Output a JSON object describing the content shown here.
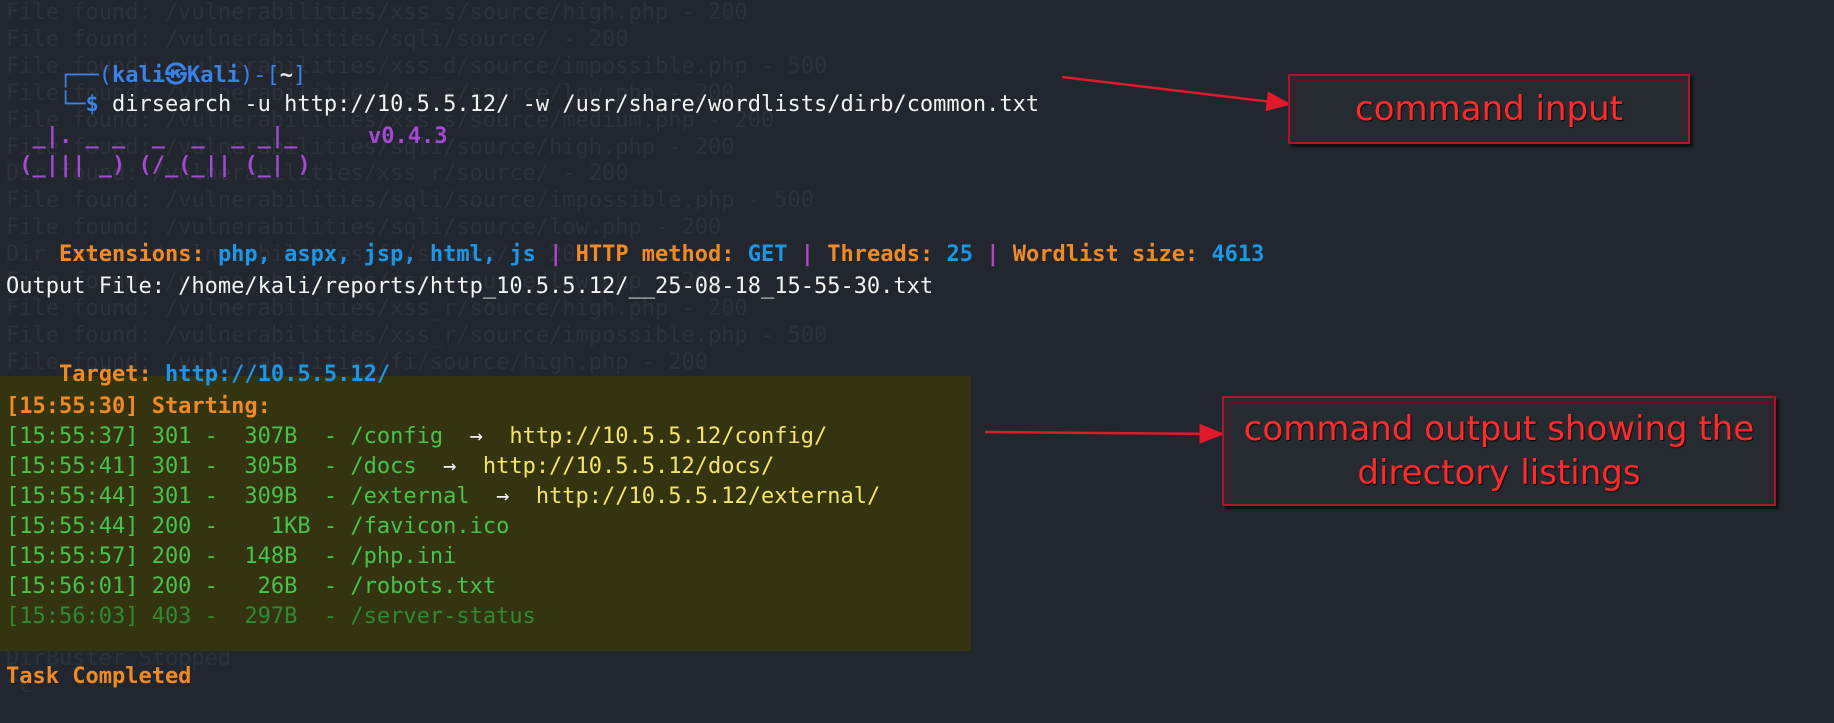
{
  "background_text": [
    "File found: /vulnerabilities/xss_s/source/high.php - 200",
    "File found: /vulnerabilities/sqli/source/ - 200",
    "File found: /vulnerabilities/xss_d/source/impossible.php - 500",
    "File found: /vulnerabilities/xss_s/source/low.php - 200",
    "File found: /vulnerabilities/xss_s/source/medium.php - 200",
    "File found: /vulnerabilities/sqli/source/high.php - 200",
    "Dir found: /vulnerabilities/xss_r/source/ - 200",
    "File found: /vulnerabilities/sqli/source/impossible.php - 500",
    "File found: /vulnerabilities/sqli/source/low.php - 200",
    "Dir found: /vulnerabilities/fi/source/ - 200",
    "File found: /vulnerabilities/csrf/source/low.php - 200",
    "File found: /vulnerabilities/xss_r/source/high.php - 200",
    "File found: /vulnerabilities/xss_r/source/impossible.php - 500",
    "File found: /vulnerabilities/fi/source/high.php - 200",
    "File found: /vulnerabilities/xss_r/source/low.php - 200",
    "File found: /vulnerabilities/xss_r/source/medium.php - 200",
    "File found: /vulnerabilities/fi/source/low.php - 200",
    "File found: /vulnerabilities/fi/source/medium.php - 200",
    "File found: /vulnerabilities/fi/source/impossible.php - 500",
    "File found: /vulnerabilities/csrf/source/high.php - 500",
    "File found: /vulnerabilities/csrf/source/impossible.php - 500",
    "File found: /vulnerabilities/csrf/source/low.php - 200",
    "File found: /vulnerabilities/csrf/source/medium.php - 200",
    "File found: /vulnerabilities/fi/include.php - 500",
    "DirBuster Stopped",
    "^C"
  ],
  "prompt": {
    "corner_top": "┌──(",
    "user": "kali",
    "at_symbol": "㉿",
    "host": "Kali",
    "dir_open": ")-[",
    "dir": "~",
    "dir_close": "]",
    "corner_bottom": "└─",
    "dollar": "$",
    "command": "dirsearch -u http://10.5.5.12/ -w /usr/share/wordlists/dirb/common.txt"
  },
  "banner": {
    "logo_line1": "  _|. _ _  _  _  _ _|_",
    "logo_line2": " (_||| _) (/_(_|| (_| )",
    "version": "v0.4.3"
  },
  "config_line": {
    "extensions_label": "Extensions:",
    "extensions_value": "php, aspx, jsp, html, js",
    "sep": "|",
    "method_label": "HTTP method:",
    "method_value": "GET",
    "threads_label": "Threads:",
    "threads_value": "25",
    "wordlist_label": "Wordlist size:",
    "wordlist_value": "4613"
  },
  "output_file": "Output File: /home/kali/reports/http_10.5.5.12/__25-08-18_15-55-30.txt",
  "target": {
    "label": "Target:",
    "url": "http://10.5.5.12/"
  },
  "starting": "[15:55:30] Starting:",
  "results": [
    {
      "text": "[15:55:37] 301 -  307B  - /config  ",
      "arrow": "→",
      "url": "  http://10.5.5.12/config/"
    },
    {
      "text": "[15:55:41] 301 -  305B  - /docs  ",
      "arrow": "→",
      "url": "  http://10.5.5.12/docs/"
    },
    {
      "text": "[15:55:44] 301 -  309B  - /external  ",
      "arrow": "→",
      "url": "  http://10.5.5.12/external/"
    },
    {
      "text": "[15:55:44] 200 -    1KB - /favicon.ico"
    },
    {
      "text": "[15:55:57] 200 -  148B  - /php.ini"
    },
    {
      "text": "[15:56:01] 200 -   26B  - /robots.txt"
    },
    {
      "text": "[15:56:03] 403 -  297B  - /server-status"
    }
  ],
  "task_completed": "Task Completed",
  "callouts": {
    "input": "command input",
    "output_line1": "command output showing the",
    "output_line2": "directory listings"
  },
  "colors": {
    "background": "#22262e",
    "orange": "#f08a24",
    "blue": "#1e96e6",
    "green": "#47c24d",
    "yellow": "#f4e56a",
    "callout_red": "#ff2a2a"
  }
}
